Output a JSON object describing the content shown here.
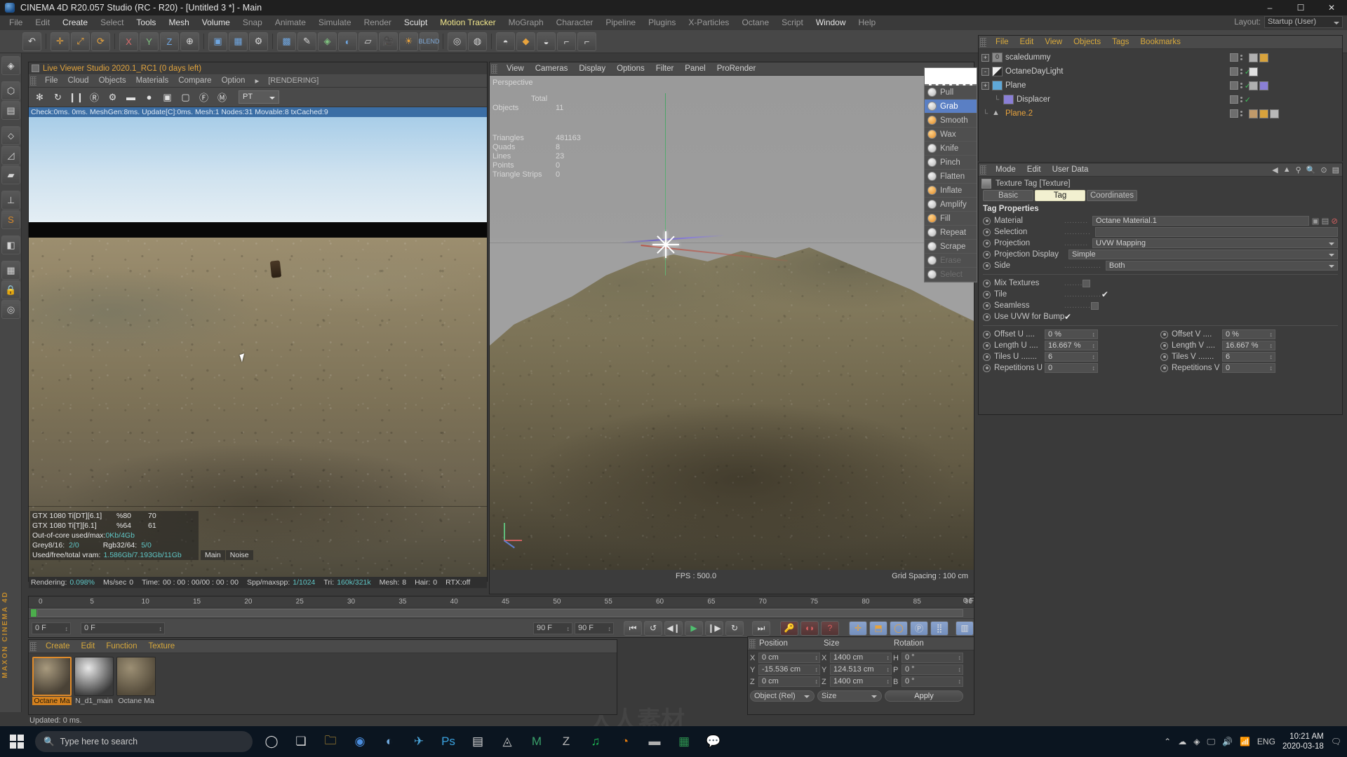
{
  "window": {
    "title": "CINEMA 4D R20.057 Studio (RC - R20) - [Untitled 3 *] - Main",
    "minimize": "–",
    "maximize": "☐",
    "close": "✕"
  },
  "menubar": {
    "items": [
      {
        "label": "File",
        "state": "dim"
      },
      {
        "label": "Edit",
        "state": "dim"
      },
      {
        "label": "Create",
        "state": "hi"
      },
      {
        "label": "Select",
        "state": "dim"
      },
      {
        "label": "Tools",
        "state": "hi"
      },
      {
        "label": "Mesh",
        "state": "hi"
      },
      {
        "label": "Volume",
        "state": "hi"
      },
      {
        "label": "Snap",
        "state": "dim"
      },
      {
        "label": "Animate",
        "state": "dim"
      },
      {
        "label": "Simulate",
        "state": "dim"
      },
      {
        "label": "Render",
        "state": "dim"
      },
      {
        "label": "Sculpt",
        "state": "hi"
      },
      {
        "label": "Motion Tracker",
        "state": "act"
      },
      {
        "label": "MoGraph",
        "state": "dim"
      },
      {
        "label": "Character",
        "state": "dim"
      },
      {
        "label": "Pipeline",
        "state": "dim"
      },
      {
        "label": "Plugins",
        "state": "dim"
      },
      {
        "label": "X-Particles",
        "state": "dim"
      },
      {
        "label": "Octane",
        "state": "dim"
      },
      {
        "label": "Script",
        "state": "dim"
      },
      {
        "label": "Window",
        "state": "hi"
      },
      {
        "label": "Help",
        "state": "dim"
      }
    ],
    "layout_label": "Layout:",
    "layout_value": "Startup (User)"
  },
  "live_viewer": {
    "title": "Live Viewer Studio 2020.1_RC1 (0 days left)",
    "menu": [
      "File",
      "Cloud",
      "Objects",
      "Materials",
      "Compare",
      "Option"
    ],
    "menu_overflow": "▸",
    "status_tag": "[RENDERING]",
    "kernel": "PT",
    "status_line": "Check:0ms. 0ms. MeshGen:8ms. Update[C]:0ms. Mesh:1 Nodes:31 Movable:8 txCached:9",
    "gpu_rows": [
      {
        "name": "GTX 1080 Ti[DT][6.1]",
        "pct": "%80",
        "temp": "70"
      },
      {
        "name": "GTX 1080 Ti[T][6.1]",
        "pct": "%64",
        "temp": "61"
      }
    ],
    "out_of_core_label": "Out-of-core used/max:",
    "out_of_core_value": "0Kb/4Gb",
    "grey_label": "Grey8/16:",
    "grey_value": "2/0",
    "rgb_label": "Rgb32/64:",
    "rgb_value": "5/0",
    "vram_label": "Used/free/total vram:",
    "vram_value": "1.586Gb/7.193Gb/11Gb",
    "tabs": [
      "Main",
      "Noise"
    ],
    "footer": {
      "rendering_label": "Rendering:",
      "rendering_value": "0.098%",
      "mssec_label": "Ms/sec",
      "mssec_value": "0",
      "time_label": "Time:",
      "time_value": "00 : 00 : 00/00 : 00 : 00",
      "spp_label": "Spp/maxspp:",
      "spp_value": "1/1024",
      "tri_label": "Tri:",
      "tri_value": "160k/321k",
      "mesh_label": "Mesh:",
      "mesh_value": "8",
      "hair_label": "Hair:",
      "hair_value": "0",
      "rtx_label": "RTX:off"
    }
  },
  "viewport": {
    "menu": [
      "View",
      "Cameras",
      "Display",
      "Options",
      "Filter",
      "Panel",
      "ProRender"
    ],
    "camera": "Perspective",
    "stats_header": "Total",
    "stats": [
      {
        "label": "Objects",
        "value": "11"
      },
      {
        "label": "Triangles",
        "value": "481163"
      },
      {
        "label": "Quads",
        "value": "8"
      },
      {
        "label": "Lines",
        "value": "23"
      },
      {
        "label": "Points",
        "value": "0"
      },
      {
        "label": "Triangle Strips",
        "value": "0"
      }
    ],
    "fps_label": "FPS : 500.0",
    "grid_label": "Grid Spacing : 100 cm"
  },
  "sculpt_menu": {
    "items": [
      {
        "label": "Pull",
        "state": "normal",
        "tone": "grey"
      },
      {
        "label": "Grab",
        "state": "selected",
        "tone": "grey"
      },
      {
        "label": "Smooth",
        "state": "normal",
        "tone": "orange"
      },
      {
        "label": "Wax",
        "state": "normal",
        "tone": "orange"
      },
      {
        "label": "Knife",
        "state": "normal",
        "tone": "grey"
      },
      {
        "label": "Pinch",
        "state": "normal",
        "tone": "grey"
      },
      {
        "label": "Flatten",
        "state": "normal",
        "tone": "grey"
      },
      {
        "label": "Inflate",
        "state": "normal",
        "tone": "orange"
      },
      {
        "label": "Amplify",
        "state": "normal",
        "tone": "grey"
      },
      {
        "label": "Fill",
        "state": "normal",
        "tone": "orange"
      },
      {
        "label": "Repeat",
        "state": "normal",
        "tone": "grey"
      },
      {
        "label": "Scrape",
        "state": "normal",
        "tone": "grey"
      },
      {
        "label": "Erase",
        "state": "disabled",
        "tone": "grey"
      },
      {
        "label": "Select",
        "state": "disabled",
        "tone": "grey"
      }
    ]
  },
  "object_manager": {
    "menu": [
      "File",
      "Edit",
      "View",
      "Objects",
      "Tags",
      "Bookmarks"
    ],
    "rows": [
      {
        "name": "scaledummy",
        "indent": 0,
        "expander": "+",
        "icon": "null-object-icon",
        "selected": false,
        "check": false
      },
      {
        "name": "OctaneDayLight",
        "indent": 0,
        "expander": "-",
        "icon": "light-icon",
        "selected": false,
        "check": true
      },
      {
        "name": "Plane",
        "indent": 0,
        "expander": "+",
        "icon": "plane-icon",
        "selected": false,
        "check": true
      },
      {
        "name": "Displacer",
        "indent": 1,
        "expander": "",
        "icon": "deformer-icon",
        "selected": false,
        "check": true
      },
      {
        "name": "Plane.2",
        "indent": 0,
        "expander": "",
        "icon": "polygon-icon",
        "selected": true,
        "check": false
      }
    ]
  },
  "attribute_manager": {
    "menu": [
      "Mode",
      "Edit",
      "User Data"
    ],
    "object_title": "Texture Tag [Texture]",
    "tabs": [
      {
        "label": "Basic",
        "active": false
      },
      {
        "label": "Tag",
        "active": true
      },
      {
        "label": "Coordinates",
        "active": false
      }
    ],
    "section_title": "Tag Properties",
    "props": [
      {
        "label": "Material",
        "dots": ".........",
        "value": "Octane Material.1",
        "type": "field"
      },
      {
        "label": "Selection",
        "dots": "..........",
        "value": "",
        "type": "field"
      },
      {
        "label": "Projection",
        "dots": ".........",
        "value": "UVW Mapping",
        "type": "select"
      },
      {
        "label": "Projection Display",
        "dots": "",
        "value": "Simple",
        "type": "select"
      },
      {
        "label": "Side",
        "dots": "..............",
        "value": "Both",
        "type": "select"
      }
    ],
    "checks": [
      {
        "label": "Mix Textures",
        "dots": ".......",
        "checked": false
      },
      {
        "label": "Tile",
        "dots": "..............",
        "checked": true
      },
      {
        "label": "Seamless",
        "dots": "..........",
        "checked": false
      },
      {
        "label": "Use UVW for Bump",
        "dots": "",
        "checked": true
      }
    ],
    "numeric": [
      {
        "l1": "Offset U",
        "d1": "....",
        "v1": "0 %",
        "l2": "Offset V",
        "d2": "....",
        "v2": "0 %"
      },
      {
        "l1": "Length U",
        "d1": "....",
        "v1": "16.667 %",
        "l2": "Length V",
        "d2": "....",
        "v2": "16.667 %"
      },
      {
        "l1": "Tiles U",
        "d1": ".......",
        "v1": "6",
        "l2": "Tiles V",
        "d2": ".......",
        "v2": "6"
      },
      {
        "l1": "Repetitions U",
        "d1": "",
        "v1": "0",
        "l2": "Repetitions V",
        "d2": "",
        "v2": "0"
      }
    ]
  },
  "timeline": {
    "ticks": [
      "0",
      "5",
      "10",
      "15",
      "20",
      "25",
      "30",
      "35",
      "40",
      "45",
      "50",
      "55",
      "60",
      "65",
      "70",
      "75",
      "80",
      "85",
      "90"
    ],
    "current_frame": "0 F",
    "frame_left": "0 F",
    "frame_right": "0 F",
    "range_end_1": "90 F",
    "range_end_2": "90 F",
    "end_marker": "0 F"
  },
  "material_manager": {
    "menu": [
      "Create",
      "Edit",
      "Function",
      "Texture"
    ],
    "materials": [
      {
        "name": "Octane Ma",
        "selected": true
      },
      {
        "name": "N_d1_main",
        "selected": false
      },
      {
        "name": "Octane Ma",
        "selected": false
      }
    ],
    "status": "Updated: 0 ms."
  },
  "coordinates": {
    "headers": [
      "Position",
      "Size",
      "Rotation"
    ],
    "rows": [
      {
        "a1": "X",
        "v1": "0 cm",
        "a2": "X",
        "v2": "1400 cm",
        "a3": "H",
        "v3": "0 °"
      },
      {
        "a1": "Y",
        "v1": "-15.536 cm",
        "a2": "Y",
        "v2": "124.513 cm",
        "a3": "P",
        "v3": "0 °"
      },
      {
        "a1": "Z",
        "v1": "0 cm",
        "a2": "Z",
        "v2": "1400 cm",
        "a3": "B",
        "v3": "0 °"
      }
    ],
    "mode": "Object (Rel)",
    "size_mode": "Size",
    "apply": "Apply"
  },
  "taskbar": {
    "search_placeholder": "Type here to search",
    "lang": "ENG",
    "time": "10:21 AM",
    "date": "2020-03-18"
  },
  "colors": {
    "accent_orange": "#e8a33c",
    "accent_blue": "#5a7fc4",
    "status_blue": "#3b6ea5",
    "panel_bg": "#3c3c3c",
    "toolbar_bg": "#474747"
  }
}
